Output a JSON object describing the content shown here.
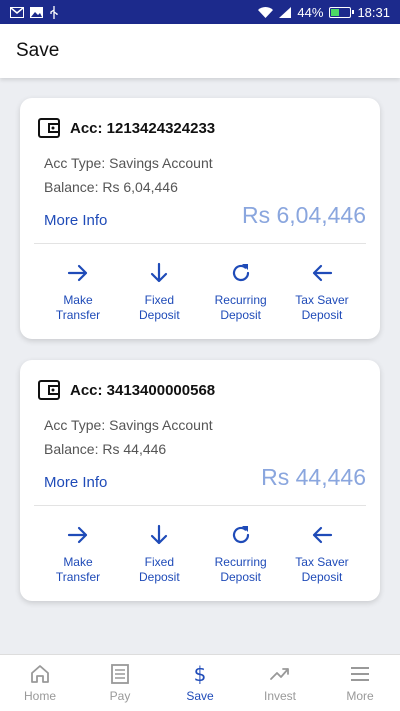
{
  "statusbar": {
    "battery": "44%",
    "battery_level": 0.44,
    "time": "18:31"
  },
  "appbar": {
    "title": "Save"
  },
  "accounts": [
    {
      "acc_label": "Acc: 1213424324233",
      "type_label": "Acc Type: Savings Account",
      "balance_label": "Balance: Rs 6,04,446",
      "more_info": "More Info",
      "big_balance": "Rs 6,04,446",
      "actions": [
        {
          "label": "Make\nTransfer",
          "icon": "arrow-right-icon"
        },
        {
          "label": "Fixed\nDeposit",
          "icon": "arrow-down-icon"
        },
        {
          "label": "Recurring\nDeposit",
          "icon": "refresh-icon"
        },
        {
          "label": "Tax Saver\nDeposit",
          "icon": "arrow-left-icon"
        }
      ]
    },
    {
      "acc_label": "Acc: 3413400000568",
      "type_label": "Acc Type: Savings Account",
      "balance_label": "Balance: Rs 44,446",
      "more_info": "More Info",
      "big_balance": "Rs 44,446",
      "actions": [
        {
          "label": "Make\nTransfer",
          "icon": "arrow-right-icon"
        },
        {
          "label": "Fixed\nDeposit",
          "icon": "arrow-down-icon"
        },
        {
          "label": "Recurring\nDeposit",
          "icon": "refresh-icon"
        },
        {
          "label": "Tax Saver\nDeposit",
          "icon": "arrow-left-icon"
        }
      ]
    }
  ],
  "bottom_nav": [
    {
      "label": "Home",
      "icon": "home-icon",
      "active": false
    },
    {
      "label": "Pay",
      "icon": "receipt-icon",
      "active": false
    },
    {
      "label": "Save",
      "icon": "dollar-icon",
      "active": true
    },
    {
      "label": "Invest",
      "icon": "trending-up-icon",
      "active": false
    },
    {
      "label": "More",
      "icon": "menu-icon",
      "active": false
    }
  ],
  "colors": {
    "statusbar": "#1c2a8c",
    "accent": "#1f4bb8",
    "balance_light": "#8aa6de",
    "inactive": "#999999"
  }
}
